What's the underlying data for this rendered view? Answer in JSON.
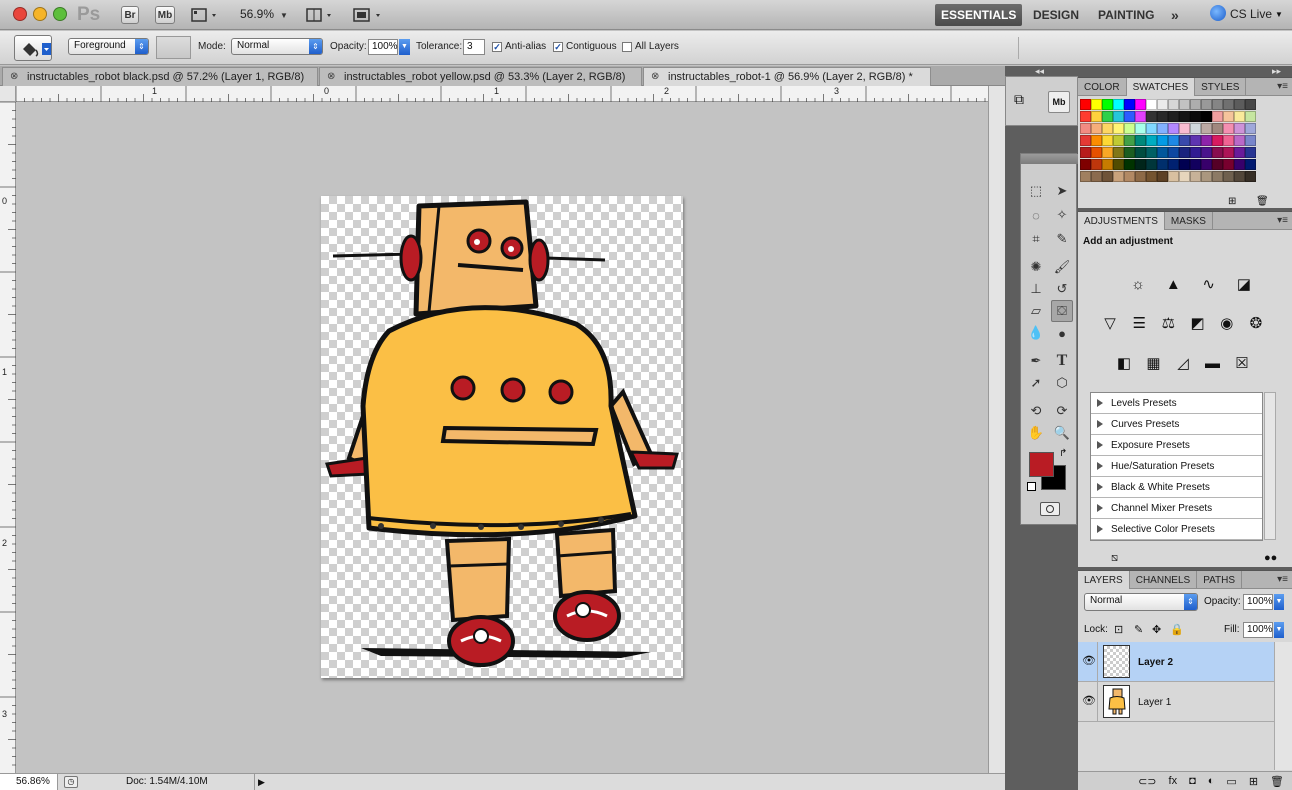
{
  "appbar": {
    "logo": "Ps",
    "bridge": "Br",
    "minibridge": "Mb",
    "zoom": "56.9%",
    "workspaces": [
      "ESSENTIALS",
      "DESIGN",
      "PAINTING"
    ],
    "more": "»",
    "cslive": "CS Live"
  },
  "options": {
    "fill_source": "Foreground",
    "mode_label": "Mode:",
    "mode": "Normal",
    "opacity_label": "Opacity:",
    "opacity": "100%",
    "tolerance_label": "Tolerance:",
    "tolerance": "3",
    "antialias": "Anti-alias",
    "contiguous": "Contiguous",
    "all_layers": "All Layers",
    "antialias_checked": true,
    "contiguous_checked": true,
    "all_layers_checked": false
  },
  "tabs": [
    {
      "label": "instructables_robot black.psd @ 57.2% (Layer 1, RGB/8)",
      "active": false
    },
    {
      "label": "instructables_robot yellow.psd @ 53.3% (Layer 2, RGB/8)",
      "active": false
    },
    {
      "label": "instructables_robot-1 @ 56.9% (Layer 2, RGB/8) *",
      "active": true
    }
  ],
  "rulers": {
    "h": [
      "1",
      "0",
      "1",
      "2",
      "3"
    ],
    "v": [
      "0",
      "1",
      "2",
      "3"
    ]
  },
  "status": {
    "zoom": "56.86%",
    "doc": "Doc: 1.54M/4.10M"
  },
  "colors": {
    "foreground": "#b91c24",
    "background": "#000000",
    "accent": "#b5d2f5"
  },
  "swatch_panel": {
    "tabs": [
      "COLOR",
      "SWATCHES",
      "STYLES"
    ],
    "active": "SWATCHES"
  },
  "adjustments_panel": {
    "tabs": [
      "ADJUSTMENTS",
      "MASKS"
    ],
    "heading": "Add an adjustment",
    "presets": [
      "Levels Presets",
      "Curves Presets",
      "Exposure Presets",
      "Hue/Saturation Presets",
      "Black & White Presets",
      "Channel Mixer Presets",
      "Selective Color Presets"
    ]
  },
  "layers_panel": {
    "tabs": [
      "LAYERS",
      "CHANNELS",
      "PATHS"
    ],
    "blend": "Normal",
    "opacity_label": "Opacity:",
    "opacity": "100%",
    "lock_label": "Lock:",
    "fill_label": "Fill:",
    "fill": "100%",
    "layers": [
      {
        "name": "Layer 2",
        "selected": true
      },
      {
        "name": "Layer 1",
        "selected": false
      }
    ]
  }
}
